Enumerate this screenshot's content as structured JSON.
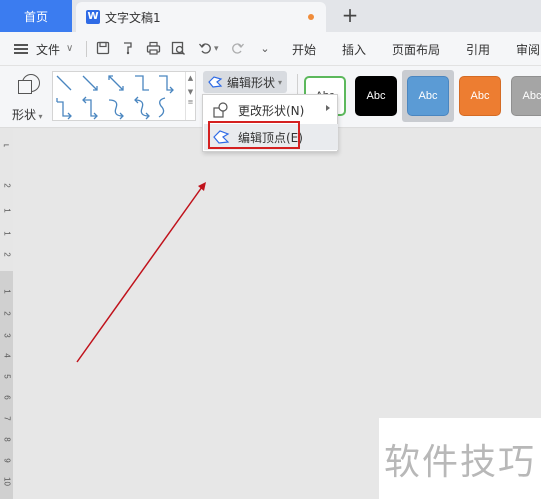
{
  "titlebar": {
    "home_tab": "首页",
    "doc_tab": "文字文稿1",
    "doc_icon": "W",
    "new_tab_icon": "plus-icon"
  },
  "menubar": {
    "file": "文件",
    "tabs": [
      "开始",
      "插入",
      "页面布局",
      "引用",
      "审阅"
    ]
  },
  "ribbon": {
    "shape_label": "形状",
    "edit_shape_label": "编辑形状",
    "style_samples": [
      {
        "text": "Abc",
        "bg": "#ffffff",
        "fg": "#333333",
        "border": "#5cb85c"
      },
      {
        "text": "Abc",
        "bg": "#000000",
        "fg": "#ffffff",
        "border": "#000000"
      },
      {
        "text": "Abc",
        "bg": "#5b9bd5",
        "fg": "#ffffff",
        "border": "#4a86c0"
      },
      {
        "text": "Abc",
        "bg": "#ed7d31",
        "fg": "#ffffff",
        "border": "#d46b25"
      },
      {
        "text": "Abc",
        "bg": "#a5a5a5",
        "fg": "#ffffff",
        "border": "#909090"
      }
    ]
  },
  "dropdown": {
    "items": [
      {
        "label": "更改形状(N)",
        "icon": "change-shape-icon",
        "submenu": true
      },
      {
        "label": "编辑顶点(E)",
        "icon": "edit-points-icon",
        "submenu": false
      }
    ]
  },
  "ruler": {
    "upper": [
      "2",
      "1",
      "3",
      "2",
      "1"
    ],
    "lower": [
      "1",
      "2",
      "3",
      "4",
      "5",
      "6",
      "7",
      "8",
      "9",
      "10"
    ]
  },
  "watermark": "软件技巧",
  "colors": {
    "accent": "#3b7cf0",
    "annotation_red": "#d42020",
    "arrow": "#c0121b"
  }
}
